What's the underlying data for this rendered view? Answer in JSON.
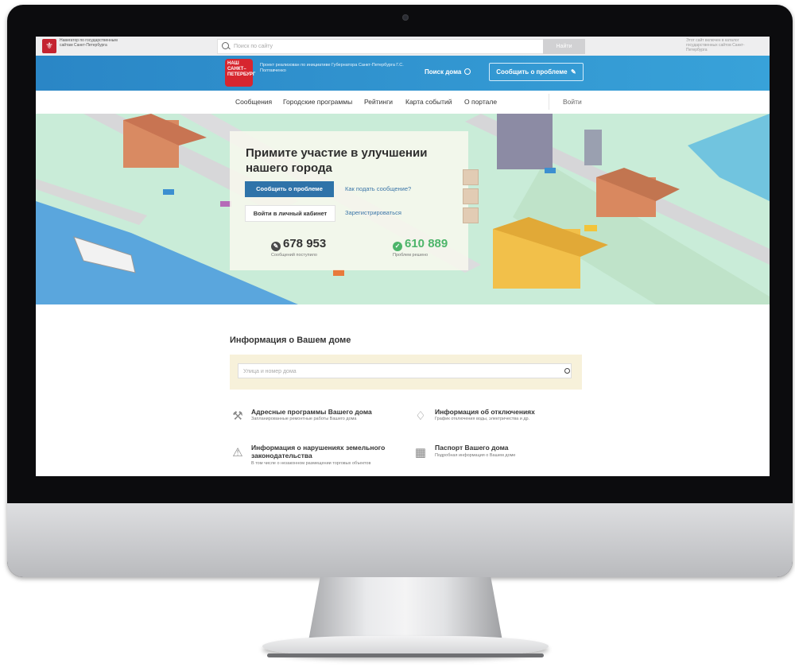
{
  "topbar": {
    "navigator_text": "Навигатор по государственным сайтам Санкт-Петербурга",
    "search_placeholder": "Поиск по сайту",
    "search_button": "Найти",
    "catalog_text": "Этот сайт включен в каталог государственных сайтов Санкт-Петербурга"
  },
  "header": {
    "logo_lines": [
      "НАШ",
      "САНКТ–",
      "ПЕТЕРБУРГ"
    ],
    "project_text": "Проект реализован по инициативе Губернатора Санкт-Петербурга Г.С. Полтавченко",
    "find_home": "Поиск дома",
    "report_button": "Сообщить о проблеме"
  },
  "menu": {
    "items": [
      "Сообщения",
      "Городские программы",
      "Рейтинги",
      "Карта событий",
      "О портале"
    ],
    "login": "Войти"
  },
  "hero": {
    "title": "Примите участие в улучшении нашего города",
    "report_button": "Сообщить о проблеме",
    "how_link": "Как подать сообщение?",
    "cabinet_button": "Войти в личный кабинет",
    "register_link": "Зарегистрироваться",
    "messages_count": "678 953",
    "messages_caption": "Сообщений поступило",
    "solved_count": "610 889",
    "solved_caption": "Проблем решено"
  },
  "info": {
    "title": "Информация о Вашем доме",
    "address_placeholder": "Улица и номер дома",
    "services": [
      {
        "title": "Адресные программы Вашего дома",
        "subtitle": "Запланированные ремонтные работы Вашего дома",
        "icon": "hammer-icon"
      },
      {
        "title": "Информация об отключениях",
        "subtitle": "График отключения воды, электричества и др.",
        "icon": "drop-icon"
      },
      {
        "title": "Информация о нарушениях земельного законодательства",
        "subtitle": "В том числе о незаконном размещении торговых объектов",
        "icon": "warning-icon"
      },
      {
        "title": "Паспорт Вашего дома",
        "subtitle": "Подробная информация о Вашем доме",
        "icon": "building-icon"
      }
    ]
  },
  "colors": {
    "header_blue": "#2f8fd0",
    "button_blue": "#2f73a9",
    "messages_green": "#2e2e2e",
    "solved_green": "#4db56a"
  }
}
